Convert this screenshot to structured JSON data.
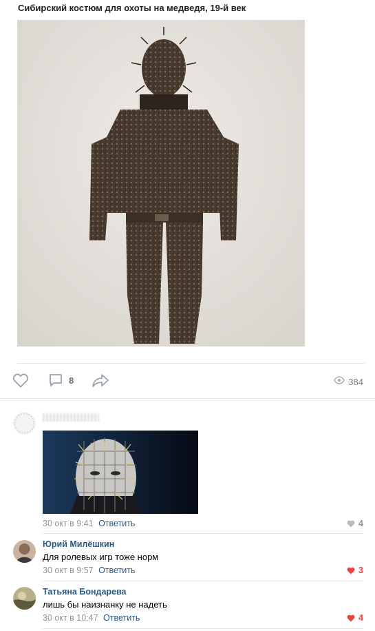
{
  "post": {
    "title": "Сибирский костюм для охоты на медведя, 19-й век"
  },
  "actions": {
    "comment_count": "8",
    "views_count": "384"
  },
  "comments": [
    {
      "author": "",
      "text": "",
      "date": "30 окт в 9:41",
      "reply_label": "Ответить",
      "likes": "4",
      "liked": false
    },
    {
      "author": "Юрий Милёшкин",
      "text": "Для ролевых игр тоже норм",
      "date": "30 окт в 9:57",
      "reply_label": "Ответить",
      "likes": "3",
      "liked": true
    },
    {
      "author": "Татьяна Бондарева",
      "text": "лишь бы наизнанку не надеть",
      "date": "30 окт в 10:47",
      "reply_label": "Ответить",
      "likes": "4",
      "liked": true
    }
  ],
  "colors": {
    "link": "#2a5885",
    "like_active": "#e64646",
    "meta": "#939393"
  },
  "icons": [
    "heart-icon",
    "comment-bubble-icon",
    "share-arrow-icon",
    "eye-icon"
  ]
}
